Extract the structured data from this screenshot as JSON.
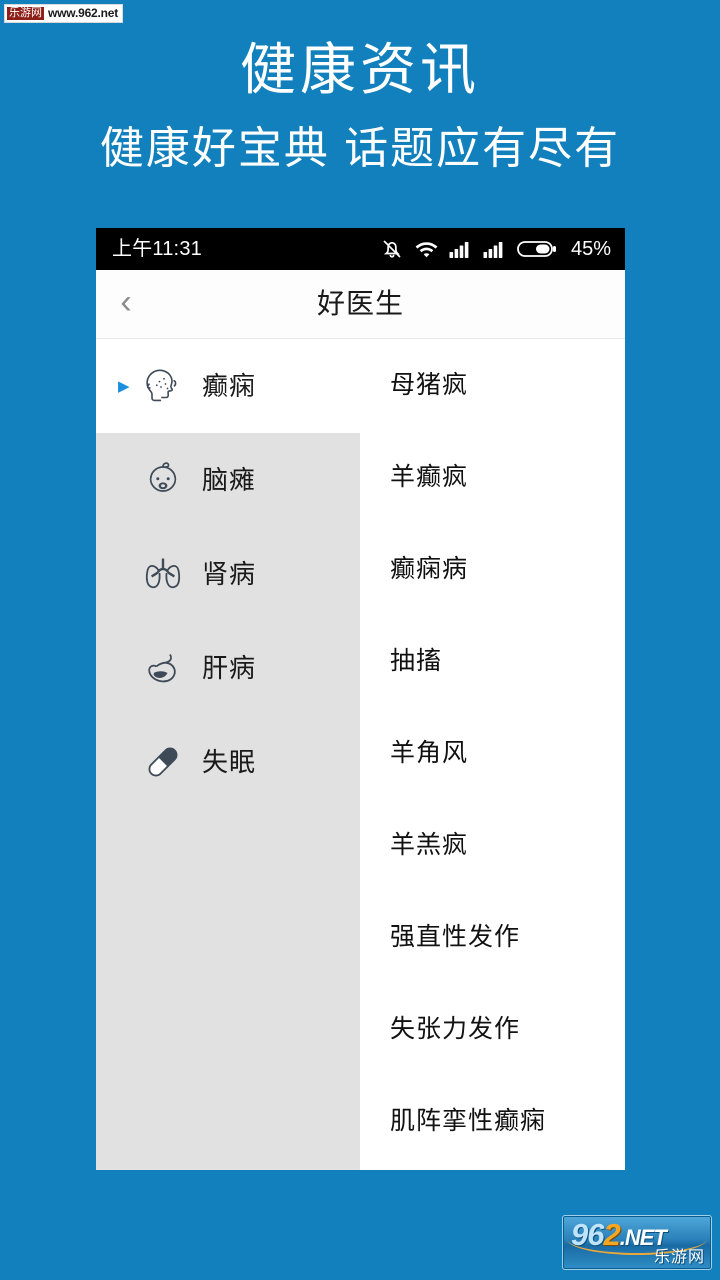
{
  "promo": {
    "title": "健康资讯",
    "subtitle": "健康好宝典 话题应有尽有",
    "background_color": "#1180bd",
    "text_color": "#ffffff"
  },
  "watermark_top": {
    "badge": "乐游网",
    "url": "www.962.net"
  },
  "watermark_logo": {
    "digits_light": "96",
    "digit_accent": "2",
    "tld": ".NET",
    "cn": "乐游网",
    "accent_color": "#f5a623"
  },
  "phone": {
    "statusbar": {
      "time": "上午11:31",
      "battery_percent": "45%",
      "icons": [
        "bell-off-icon",
        "wifi-icon",
        "signal-icon",
        "signal-icon",
        "battery-icon"
      ]
    },
    "appbar": {
      "back_glyph": "‹",
      "title": "好医生"
    },
    "sidebar": {
      "selected_index": 0,
      "marker_glyph": "▶",
      "accent_color": "#1a8fe0",
      "items": [
        {
          "label": "癫痫",
          "icon": "head-profile-icon"
        },
        {
          "label": "脑瘫",
          "icon": "baby-face-icon"
        },
        {
          "label": "肾病",
          "icon": "lungs-icon"
        },
        {
          "label": "肝病",
          "icon": "liver-icon"
        },
        {
          "label": "失眠",
          "icon": "pill-capsule-icon"
        }
      ]
    },
    "list": {
      "items": [
        {
          "label": "母猪疯"
        },
        {
          "label": "羊癫疯"
        },
        {
          "label": "癫痫病"
        },
        {
          "label": "抽搐"
        },
        {
          "label": "羊角风"
        },
        {
          "label": "羊羔疯"
        },
        {
          "label": "强直性发作"
        },
        {
          "label": "失张力发作"
        },
        {
          "label": "肌阵挛性癫痫"
        }
      ]
    }
  }
}
